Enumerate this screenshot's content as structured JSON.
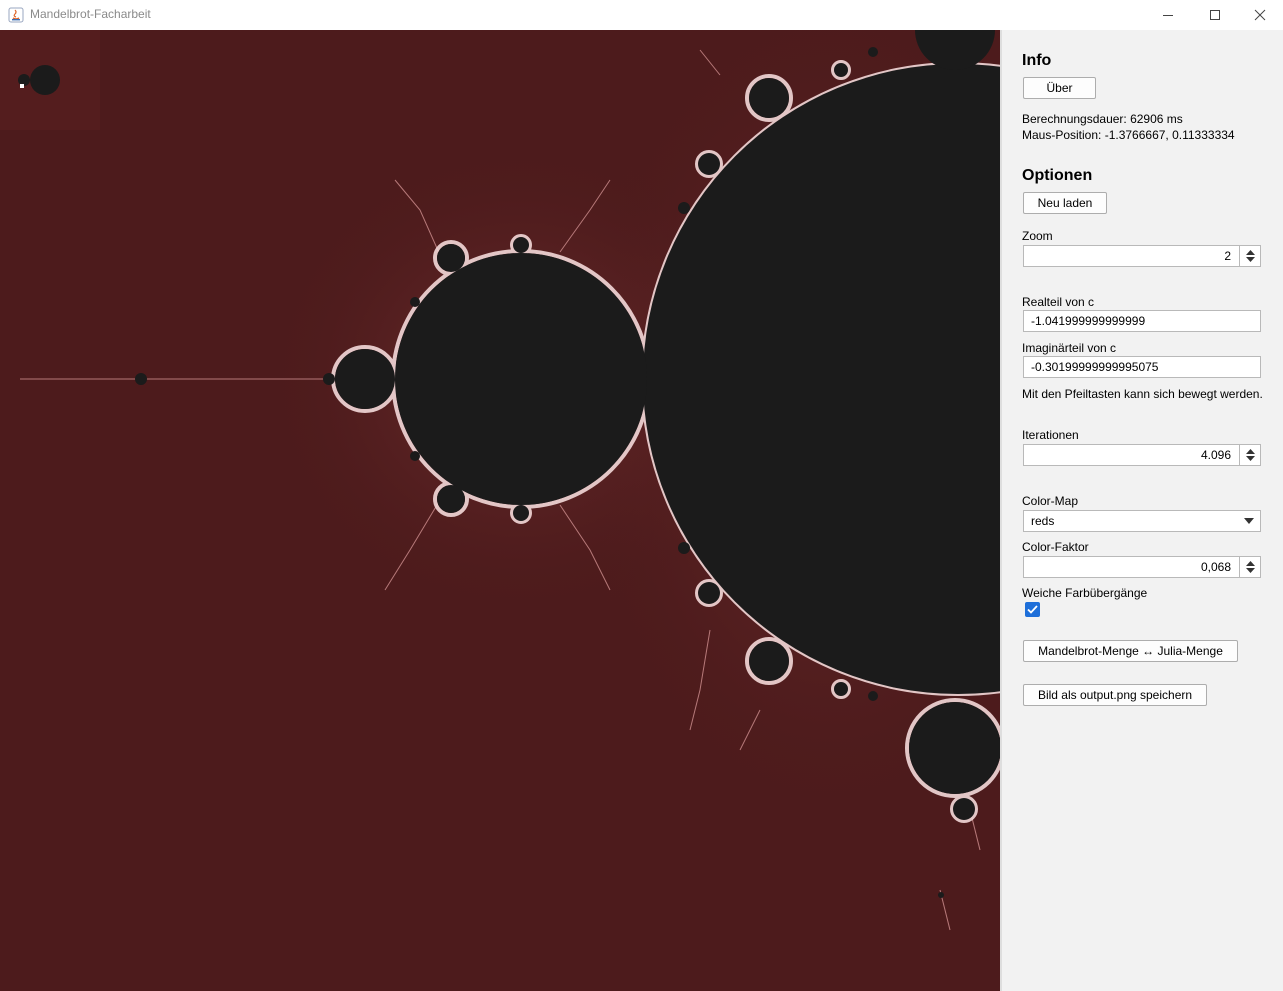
{
  "window": {
    "title": "Mandelbrot-Facharbeit"
  },
  "canvas": {
    "background_color": "#4d1b1c",
    "set_color": "#1b1b1b",
    "edge_color": "#f3d9d9"
  },
  "info": {
    "heading": "Info",
    "about_button": "Über",
    "calc_duration": "Berechnungsdauer: 62906 ms",
    "mouse_position": "Maus-Position: -1.3766667, 0.11333334"
  },
  "options": {
    "heading": "Optionen",
    "reload_button": "Neu laden",
    "zoom_label": "Zoom",
    "zoom_value": "2",
    "real_label": "Realteil von c",
    "real_value": "-1.041999999999999",
    "imag_label": "Imaginärteil von c",
    "imag_value": "-0.30199999999995075",
    "arrow_hint": "Mit den Pfeiltasten kann sich bewegt werden.",
    "iterations_label": "Iterationen",
    "iterations_value": "4.096",
    "colormap_label": "Color-Map",
    "colormap_value": "reds",
    "colorfactor_label": "Color-Faktor",
    "colorfactor_value": "0,068",
    "smooth_label": "Weiche Farbübergänge",
    "smooth_checked": true,
    "toggle_set_button": "Mandelbrot-Menge ↔ Julia-Menge",
    "save_button": "Bild als output.png speichern"
  },
  "colors": {
    "checkbox_accent": "#1e6fd9"
  }
}
